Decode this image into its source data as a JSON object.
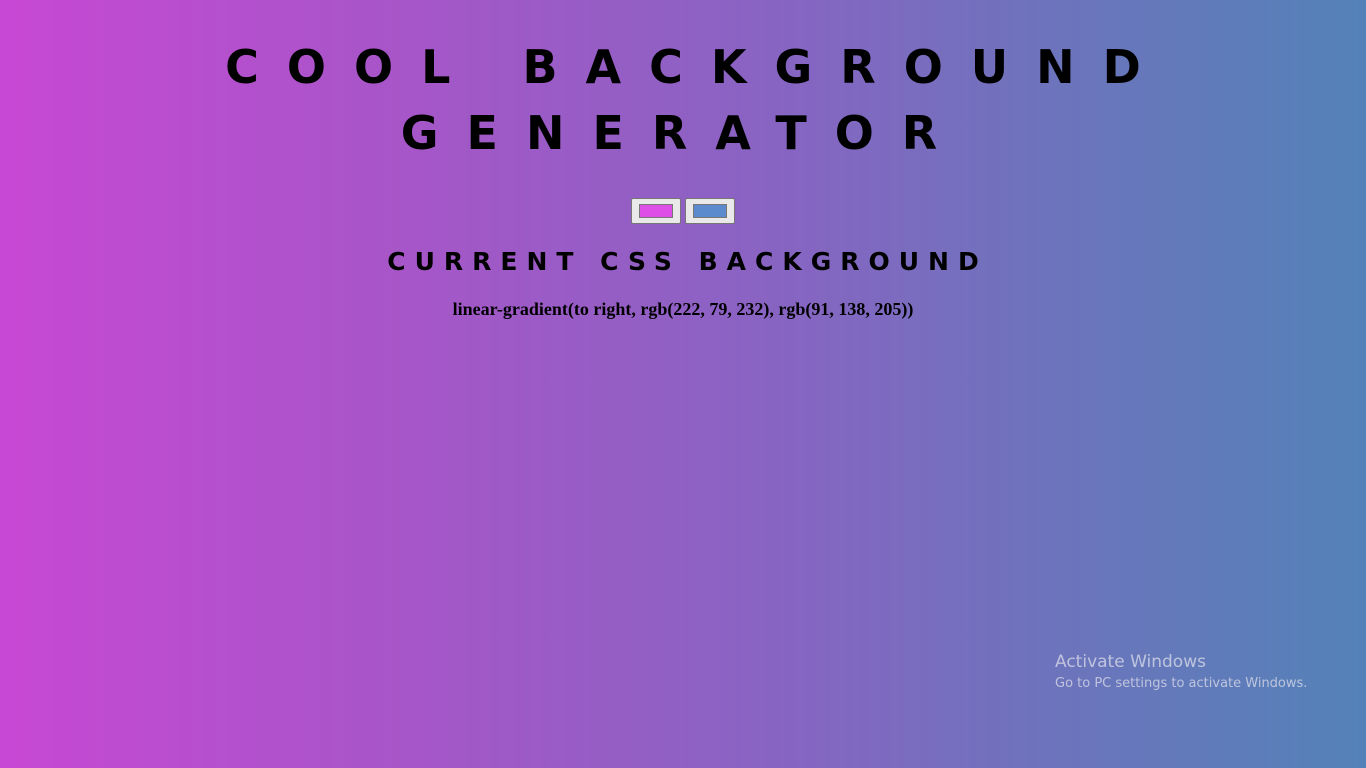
{
  "header": {
    "title_line1": "COOL BACKGROUND",
    "title_line2": "GENERATOR"
  },
  "pickers": {
    "color1": "#de4fe8",
    "color2": "#5b8acd"
  },
  "subtitle": "CURRENT CSS BACKGROUND",
  "css_value": "linear-gradient(to right, rgb(222, 79, 232), rgb(91, 138, 205))",
  "watermark": {
    "title": "Activate Windows",
    "subtitle": "Go to PC settings to activate Windows."
  }
}
